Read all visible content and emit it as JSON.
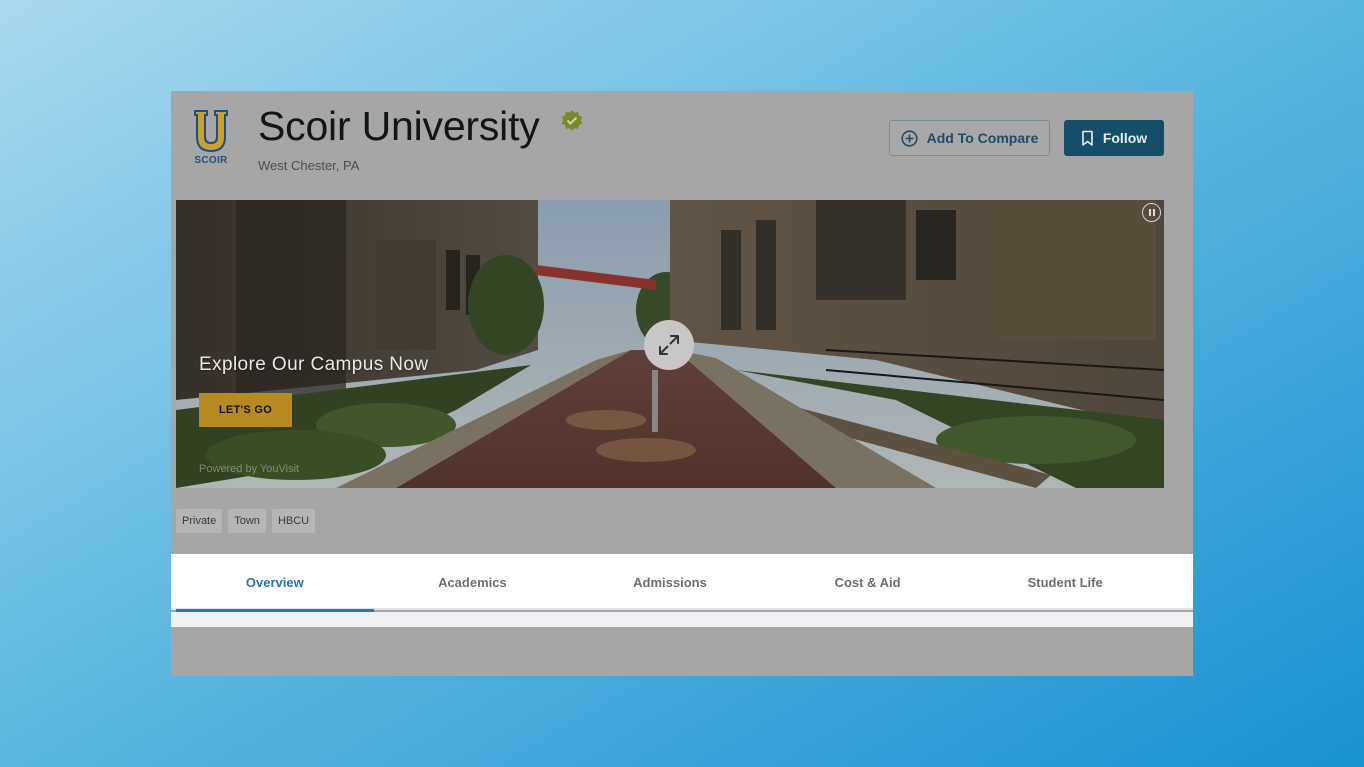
{
  "university": {
    "name": "Scoir University",
    "location": "West Chester, PA",
    "logo_text": "SCOIR",
    "logo_letter": "U"
  },
  "actions": {
    "compare_label": "Add To Compare",
    "follow_label": "Follow"
  },
  "hero": {
    "heading": "Explore Our Campus Now",
    "cta_label": "LET'S GO",
    "powered_by": "Powered by YouVisit"
  },
  "tags": [
    "Private",
    "Town",
    "HBCU"
  ],
  "tabs": [
    {
      "label": "Overview",
      "active": true
    },
    {
      "label": "Academics",
      "active": false
    },
    {
      "label": "Admissions",
      "active": false
    },
    {
      "label": "Cost & Aid",
      "active": false
    },
    {
      "label": "Student Life",
      "active": false
    }
  ],
  "colors": {
    "primary": "#164d68",
    "accent_gold": "#b88a22",
    "active_tab": "#2a76a8",
    "verified_badge": "#7a8a2a"
  },
  "icons": {
    "compare": "plus-circle-icon",
    "follow": "bookmark-icon",
    "verified": "verified-badge-icon",
    "expand": "expand-arrows-icon",
    "pause": "pause-icon"
  }
}
